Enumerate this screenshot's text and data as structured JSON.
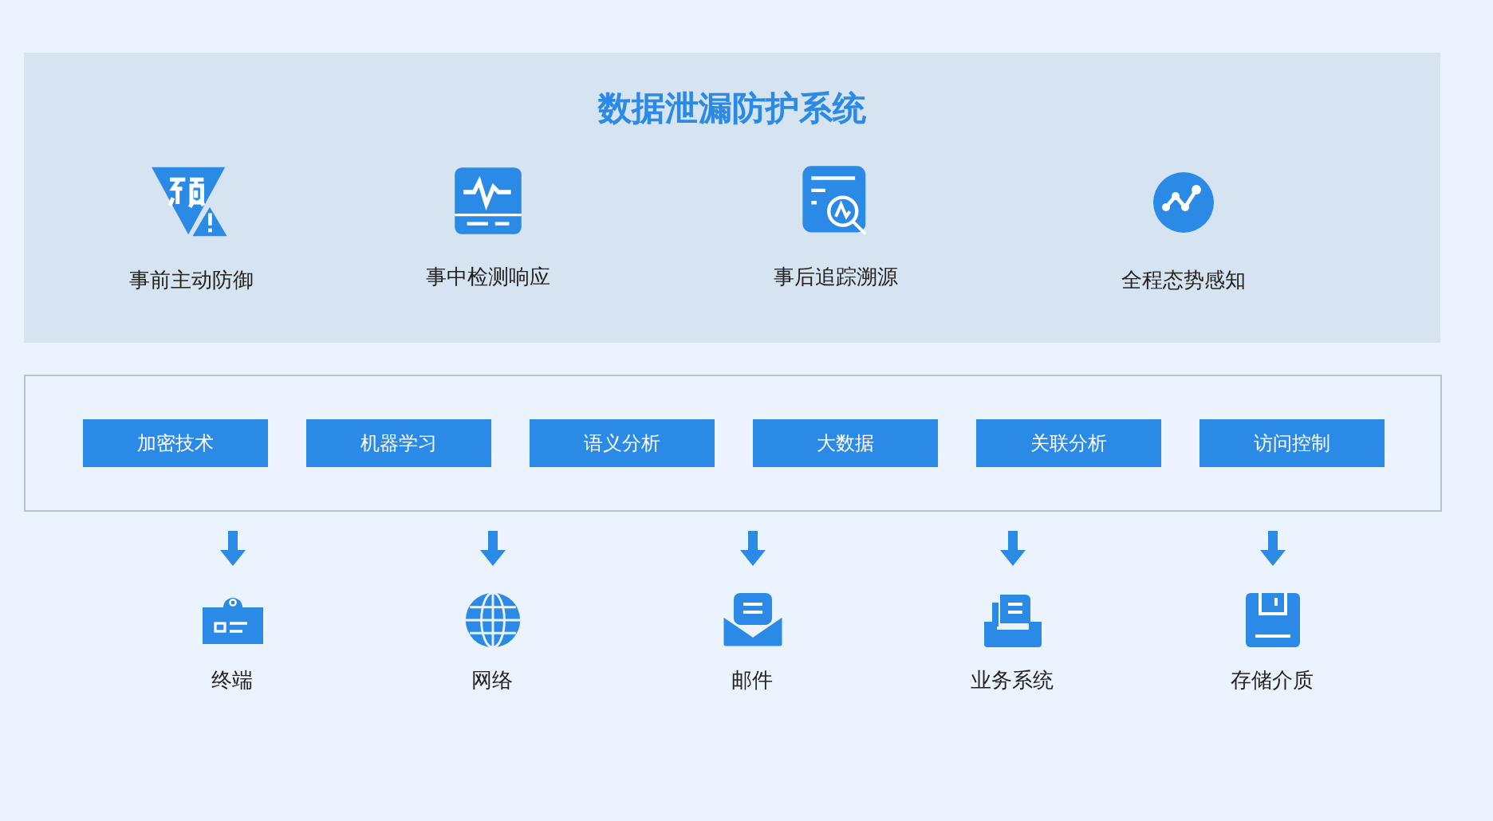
{
  "title": "数据泄漏防护系统",
  "features": [
    {
      "label": "事前主动防御"
    },
    {
      "label": "事中检测响应"
    },
    {
      "label": "事后追踪溯源"
    },
    {
      "label": "全程态势感知"
    }
  ],
  "technologies": [
    "加密技术",
    "机器学习",
    "语义分析",
    "大数据",
    "关联分析",
    "访问控制"
  ],
  "channels": [
    {
      "label": "终端"
    },
    {
      "label": "网络"
    },
    {
      "label": "邮件"
    },
    {
      "label": "业务系统"
    },
    {
      "label": "存储介质"
    }
  ]
}
